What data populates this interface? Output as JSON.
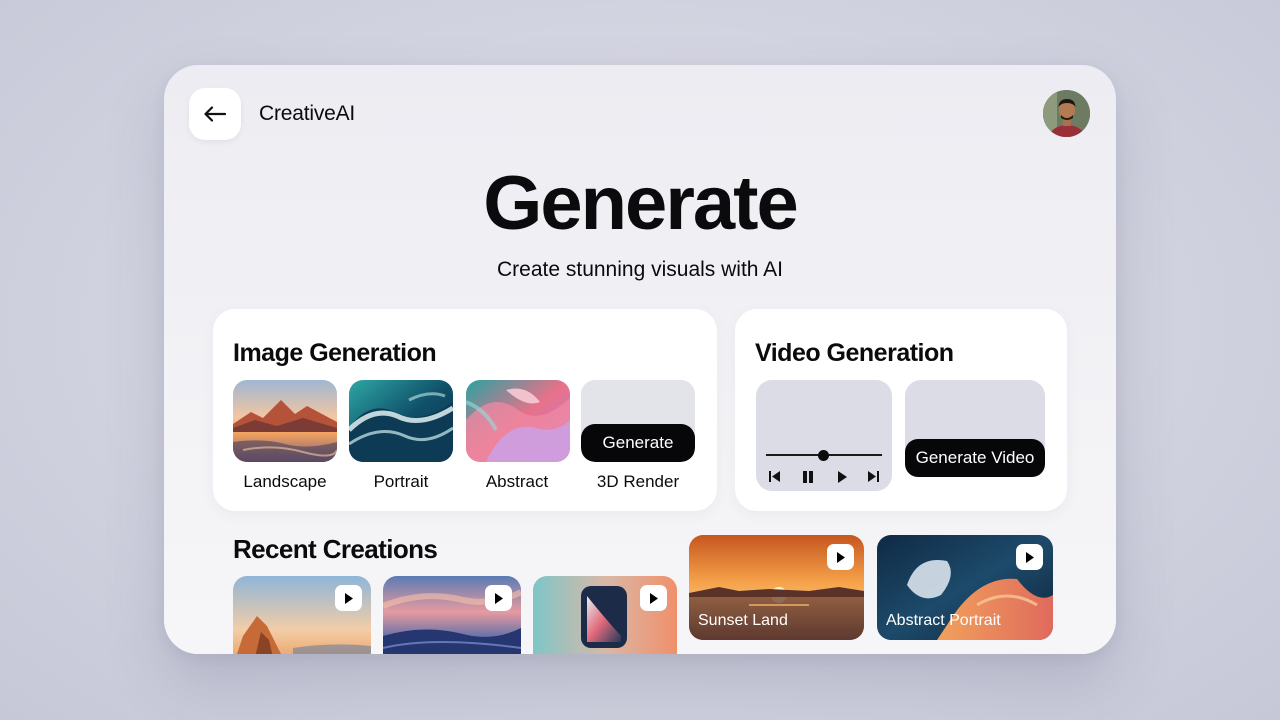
{
  "header": {
    "brand": "CreativeAI",
    "back_icon": "arrow-left-icon",
    "avatar": "user-avatar"
  },
  "hero": {
    "title": "Generate",
    "subtitle": "Create stunning visuals with AI"
  },
  "image_generation": {
    "title": "Image Generation",
    "items": [
      {
        "label": "Landscape"
      },
      {
        "label": "Portrait"
      },
      {
        "label": "Abstract"
      },
      {
        "label": "3D Render",
        "button": "Generate"
      }
    ]
  },
  "video_generation": {
    "title": "Video Generation",
    "player": {
      "progress": 0.5,
      "controls": [
        "skip-back-icon",
        "pause-icon",
        "play-icon",
        "skip-forward-icon"
      ]
    },
    "generate_button": "Generate Video"
  },
  "recent": {
    "title": "Recent Creations",
    "items": [
      {
        "label": ""
      },
      {
        "label": ""
      },
      {
        "label": ""
      },
      {
        "label": "Sunset Land"
      },
      {
        "label": "Abstract Portrait"
      }
    ]
  },
  "colors": {
    "accent": "#070709",
    "card": "#ffffff",
    "placeholder": "#dcdce6"
  }
}
